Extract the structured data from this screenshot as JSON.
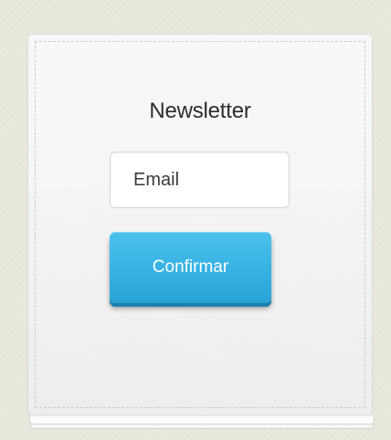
{
  "newsletter": {
    "title": "Newsletter",
    "email_placeholder": "Email",
    "submit_label": "Confirmar"
  },
  "colors": {
    "accent": "#36b2e3",
    "background": "#e9e8dc"
  }
}
